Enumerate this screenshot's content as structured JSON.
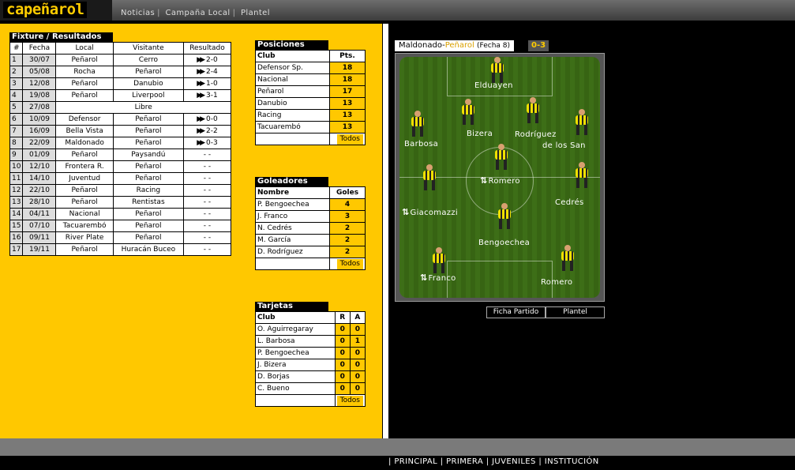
{
  "logo": "capeñarol",
  "topnav": [
    "Noticias",
    "Campaña Local",
    "Plantel"
  ],
  "fixture": {
    "title": "Fixture / Resultados",
    "columns": [
      "#",
      "Fecha",
      "Local",
      "Visitante",
      "Resultado"
    ],
    "rows": [
      [
        "1",
        "30/07",
        "Peñarol",
        "Cerro",
        "2-0",
        true
      ],
      [
        "2",
        "05/08",
        "Rocha",
        "Peñarol",
        "2-4",
        true
      ],
      [
        "3",
        "12/08",
        "Peñarol",
        "Danubio",
        "1-0",
        true
      ],
      [
        "4",
        "19/08",
        "Peñarol",
        "Liverpool",
        "3-1",
        true
      ],
      [
        "5",
        "27/08",
        "Libre",
        "",
        "",
        false
      ],
      [
        "6",
        "10/09",
        "Defensor",
        "Peñarol",
        "0-0",
        true
      ],
      [
        "7",
        "16/09",
        "Bella Vista",
        "Peñarol",
        "2-2",
        true
      ],
      [
        "8",
        "22/09",
        "Maldonado",
        "Peñarol",
        "0-3",
        true
      ],
      [
        "9",
        "01/09",
        "Peñarol",
        "Paysandú",
        "- -",
        false
      ],
      [
        "10",
        "12/10",
        "Frontera R.",
        "Peñarol",
        "- -",
        false
      ],
      [
        "11",
        "14/10",
        "Juventud",
        "Peñarol",
        "- -",
        false
      ],
      [
        "12",
        "22/10",
        "Peñarol",
        "Racing",
        "- -",
        false
      ],
      [
        "13",
        "28/10",
        "Peñarol",
        "Rentistas",
        "- -",
        false
      ],
      [
        "14",
        "04/11",
        "Nacional",
        "Peñarol",
        "- -",
        false
      ],
      [
        "15",
        "07/10",
        "Tacuarembó",
        "Peñarol",
        "- -",
        false
      ],
      [
        "16",
        "09/11",
        "River Plate",
        "Peñarol",
        "- -",
        false
      ],
      [
        "17",
        "19/11",
        "Peñarol",
        "Huracán Buceo",
        "- -",
        false
      ]
    ]
  },
  "posiciones": {
    "title": "Posiciones",
    "col_club": "Club",
    "col_pts": "Pts.",
    "rows": [
      [
        "Defensor Sp.",
        "18"
      ],
      [
        "Nacional",
        "18"
      ],
      [
        "Peñarol",
        "17"
      ],
      [
        "Danubio",
        "13"
      ],
      [
        "Racing",
        "13"
      ],
      [
        "Tacuarembó",
        "13"
      ]
    ],
    "todos": "Todos"
  },
  "goleadores": {
    "title": "Goleadores",
    "col_name": "Nombre",
    "col_goals": "Goles",
    "rows": [
      [
        "P. Bengoechea",
        "4"
      ],
      [
        "J. Franco",
        "3"
      ],
      [
        "N. Cedrés",
        "2"
      ],
      [
        "M. García",
        "2"
      ],
      [
        "D. Rodríguez",
        "2"
      ]
    ],
    "todos": "Todos"
  },
  "tarjetas": {
    "title": "Tarjetas",
    "col_club": "Club",
    "col_r": "R",
    "col_a": "A",
    "rows": [
      [
        "O. Aguirregaray",
        "0",
        "0"
      ],
      [
        "L. Barbosa",
        "0",
        "1"
      ],
      [
        "P. Bengoechea",
        "0",
        "0"
      ],
      [
        "J. Bizera",
        "0",
        "0"
      ],
      [
        "D. Borjas",
        "0",
        "0"
      ],
      [
        "C. Bueno",
        "0",
        "0"
      ]
    ],
    "todos": "Todos"
  },
  "match": {
    "home": "Maldonado",
    "dash": "-",
    "away": "Peñarol",
    "round": "(Fecha 8)",
    "score": "0-3"
  },
  "players": [
    {
      "name": "Elduayen",
      "sub": false
    },
    {
      "name": "Barbosa",
      "sub": false
    },
    {
      "name": "Bizera",
      "sub": false
    },
    {
      "name": "Rodríguez",
      "sub": false
    },
    {
      "name": "de los San",
      "sub": false
    },
    {
      "name": "Romero",
      "sub": true
    },
    {
      "name": "Giacomazzi",
      "sub": true
    },
    {
      "name": "Cedrés",
      "sub": false
    },
    {
      "name": "Bengoechea",
      "sub": false
    },
    {
      "name": "Franco",
      "sub": true
    },
    {
      "name": "Romero",
      "sub": false
    }
  ],
  "tabs": [
    "Ficha Partido",
    "Plantel"
  ],
  "bottomnav": [
    "PRINCIPAL",
    "PRIMERA",
    "JUVENILES",
    "INSTITUCIÓN"
  ],
  "colors": {
    "accent": "#ffc800",
    "pitch": "#3a6a15"
  }
}
